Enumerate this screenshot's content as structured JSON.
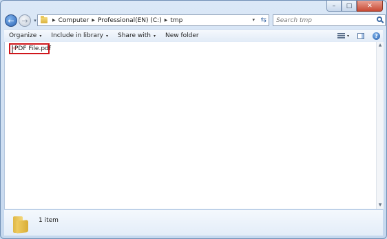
{
  "window": {
    "caption_buttons": [
      {
        "name": "minimize",
        "glyph": "–"
      },
      {
        "name": "maximize",
        "glyph": "□"
      },
      {
        "name": "close",
        "glyph": "✕"
      }
    ]
  },
  "nav": {
    "back_glyph": "←",
    "forward_glyph": "→",
    "recent_glyph": "▾"
  },
  "address": {
    "breadcrumbs": [
      "Computer",
      "Professional(EN) (C:)",
      "tmp"
    ],
    "separator": "▶",
    "dropdown_glyph": "▾",
    "refresh_glyph": "⇆"
  },
  "search": {
    "placeholder": "Search tmp"
  },
  "toolbar": {
    "organize": "Organize",
    "include_in_library": "Include in library",
    "share_with": "Share with",
    "new_folder": "New folder",
    "arrow": "▾",
    "help": "?"
  },
  "files": [
    {
      "name": "PDF File.pdf",
      "type": "pdf",
      "selected_highlight": true
    }
  ],
  "status": {
    "count": "1 item"
  },
  "colors": {
    "highlight_border": "#d0161b",
    "accent": "#2c64b4"
  }
}
